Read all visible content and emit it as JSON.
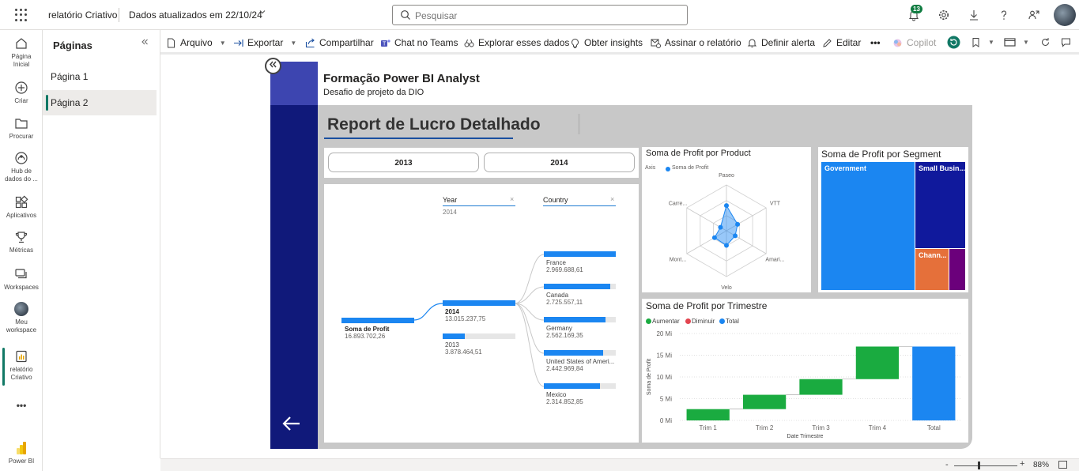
{
  "topbar": {
    "app_name": "relatório Criativo",
    "updated": "Dados atualizados em 22/10/24",
    "search_placeholder": "Pesquisar",
    "notification_count": "13"
  },
  "leftnav": {
    "items": [
      {
        "label_1": "Página",
        "label_2": "Inicial",
        "icon": "home-icon"
      },
      {
        "label_1": "Criar",
        "label_2": "",
        "icon": "plus-circle-icon"
      },
      {
        "label_1": "Procurar",
        "label_2": "",
        "icon": "folder-icon"
      },
      {
        "label_1": "Hub de",
        "label_2": "dados do ...",
        "icon": "data-hub-icon"
      },
      {
        "label_1": "Aplicativos",
        "label_2": "",
        "icon": "apps-icon"
      },
      {
        "label_1": "Métricas",
        "label_2": "",
        "icon": "trophy-icon"
      },
      {
        "label_1": "Workspaces",
        "label_2": "",
        "icon": "workspaces-icon"
      },
      {
        "label_1": "Meu",
        "label_2": "workspace",
        "icon": "workspace-avatar-icon"
      },
      {
        "label_1": "relatório",
        "label_2": "Criativo",
        "icon": "report-icon"
      },
      {
        "label_1": "Power BI",
        "label_2": "",
        "icon": "powerbi-logo-icon"
      }
    ],
    "more": "•••"
  },
  "pages_pane": {
    "title": "Páginas",
    "pages": [
      "Página 1",
      "Página 2"
    ],
    "selected": "Página 2"
  },
  "actionbar": {
    "file": "Arquivo",
    "export": "Exportar",
    "share": "Compartilhar",
    "teams": "Chat no Teams",
    "explore": "Explorar esses dados",
    "insights": "Obter insights",
    "subscribe": "Assinar o relatório",
    "alert": "Definir alerta",
    "edit": "Editar",
    "more": "•••",
    "copilot": "Copilot"
  },
  "report": {
    "title": "Formação Power BI Analyst",
    "subtitle": "Desafio de projeto da DIO",
    "heading": "Report de Lucro Detalhado",
    "slicer_years": [
      "2013",
      "2014"
    ]
  },
  "decomposition_tree": {
    "root_label": "Soma de Profit",
    "root_value": "16.893.702,26",
    "year_header": "Year",
    "year_selected": "2014",
    "country_header": "Country",
    "close_symbol": "×",
    "years": [
      {
        "label": "2014",
        "value": "13.015.237,75",
        "share": 1.0,
        "bold": true
      },
      {
        "label": "2013",
        "value": "3.878.464,51",
        "share": 0.3,
        "bold": false
      }
    ],
    "countries": [
      {
        "label": "France",
        "value": "2.969.688,61",
        "share": 1.0
      },
      {
        "label": "Canada",
        "value": "2.725.557,11",
        "share": 0.92
      },
      {
        "label": "Germany",
        "value": "2.562.169,35",
        "share": 0.86
      },
      {
        "label": "United States of Ameri...",
        "value": "2.442.969,84",
        "share": 0.82
      },
      {
        "label": "Mexico",
        "value": "2.314.852,85",
        "share": 0.78
      }
    ]
  },
  "radar_card": {
    "title": "Soma de Profit por Product",
    "legend_axis": "Axis",
    "legend_series": "Soma de Profit",
    "series_color": "#1b86f1"
  },
  "treemap_card": {
    "title": "Soma de Profit por Segment",
    "segments": [
      {
        "label": "Government",
        "color": "#1b86f1"
      },
      {
        "label": "Small Busin...",
        "color": "#10199c"
      },
      {
        "label": "Chann...",
        "color": "#e5703a"
      },
      {
        "label": "",
        "color": "#6b007b"
      }
    ]
  },
  "waterfall_card": {
    "title": "Soma de Profit por Trimestre",
    "legend": [
      {
        "label": "Aumentar",
        "color": "#1aab40"
      },
      {
        "label": "Diminuir",
        "color": "#e3454f"
      },
      {
        "label": "Total",
        "color": "#1b86f1"
      }
    ]
  },
  "chart_data": [
    {
      "type": "radar",
      "title": "Soma de Profit por Product",
      "categories": [
        "Paseo",
        "VTT",
        "Amari...",
        "Velo",
        "Mont...",
        "Carre..."
      ],
      "values": [
        0.55,
        0.28,
        0.22,
        0.32,
        0.3,
        0.15
      ],
      "series": [
        {
          "name": "Soma de Profit"
        }
      ]
    },
    {
      "type": "treemap",
      "title": "Soma de Profit por Segment",
      "categories": [
        "Government",
        "Small Busin...",
        "Chann...",
        ""
      ],
      "values": [
        0.54,
        0.29,
        0.11,
        0.06
      ]
    },
    {
      "type": "waterfall",
      "title": "Soma de Profit por Trimestre",
      "categories": [
        "Trim 1",
        "Trim 2",
        "Trim 3",
        "Trim 4",
        "Total"
      ],
      "values": [
        2.6,
        3.3,
        3.6,
        7.5,
        17.0
      ],
      "xlabel": "Date Trimestre",
      "ylabel": "Soma de Profit",
      "ylim": [
        0,
        20
      ],
      "yticks": [
        "0 Mi",
        "5 Mi",
        "10 Mi",
        "15 Mi",
        "20 Mi"
      ]
    }
  ],
  "statusbar": {
    "zoom_minus": "-",
    "zoom_plus": "+",
    "zoom_level": "88%"
  }
}
